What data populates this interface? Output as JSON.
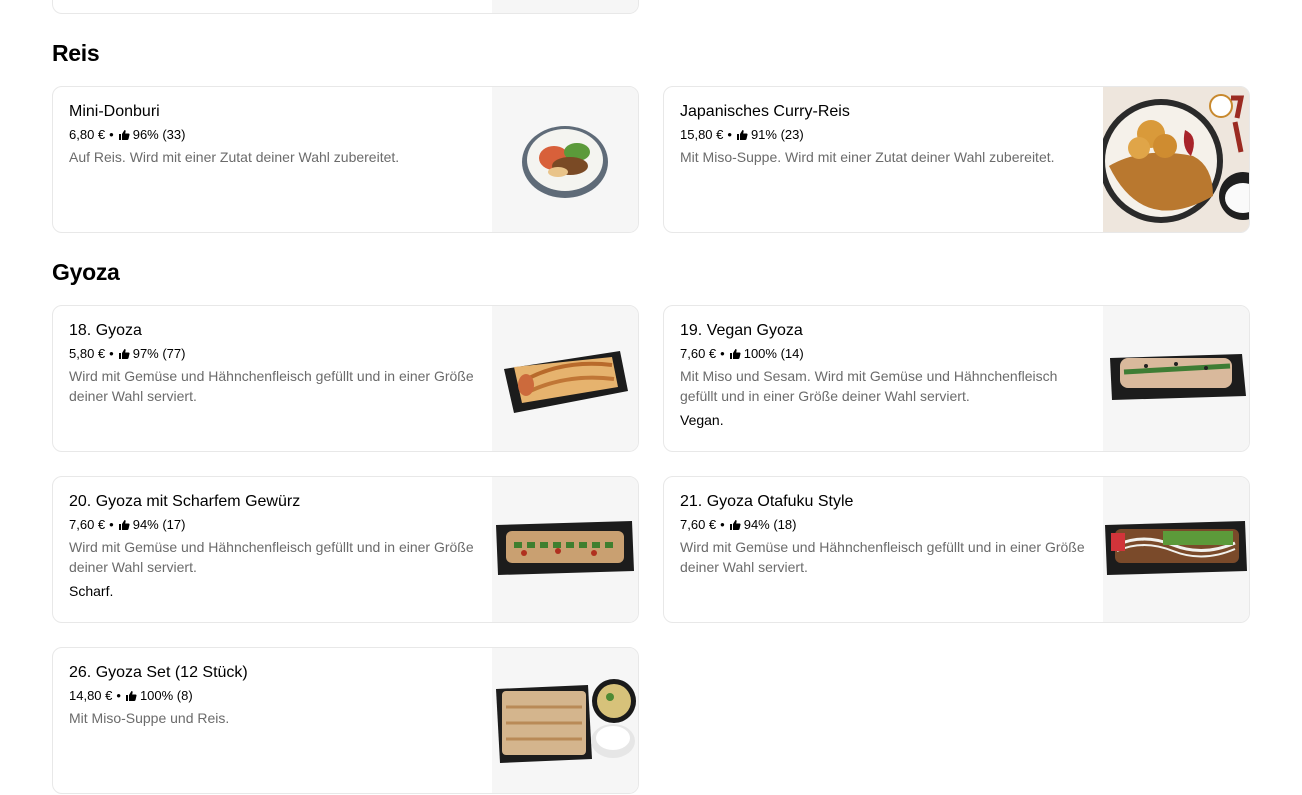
{
  "sections": [
    {
      "title": "Reis",
      "items": [
        {
          "name": "Mini-Donburi",
          "price": "6,80 €",
          "rating": "96% (33)",
          "description": "Auf Reis. Wird mit einer Zutat deiner Wahl zubereitet.",
          "tag": ""
        },
        {
          "name": "Japanisches Curry-Reis",
          "price": "15,80 €",
          "rating": "91% (23)",
          "description": "Mit Miso-Suppe. Wird mit einer Zutat deiner Wahl zubereitet.",
          "tag": ""
        }
      ]
    },
    {
      "title": "Gyoza",
      "items": [
        {
          "name": "18. Gyoza",
          "price": "5,80 €",
          "rating": "97% (77)",
          "description": "Wird mit Gemüse und Hähnchenfleisch gefüllt und in einer Größe deiner Wahl serviert.",
          "tag": ""
        },
        {
          "name": "19. Vegan Gyoza",
          "price": "7,60 €",
          "rating": "100% (14)",
          "description": "Mit Miso und Sesam. Wird mit Gemüse und Hähnchenfleisch gefüllt und in einer Größe deiner Wahl serviert.",
          "tag": "Vegan."
        },
        {
          "name": "20. Gyoza mit Scharfem Gewürz",
          "price": "7,60 €",
          "rating": "94% (17)",
          "description": "Wird mit Gemüse und Hähnchenfleisch gefüllt und in einer Größe deiner Wahl serviert.",
          "tag": "Scharf."
        },
        {
          "name": "21. Gyoza Otafuku Style",
          "price": "7,60 €",
          "rating": "94% (18)",
          "description": "Wird mit Gemüse und Hähnchenfleisch gefüllt und in einer Größe deiner Wahl serviert.",
          "tag": ""
        },
        {
          "name": "26. Gyoza Set (12 Stück)",
          "price": "14,80 €",
          "rating": "100% (8)",
          "description": "Mit Miso-Suppe und Reis.",
          "tag": ""
        }
      ]
    }
  ],
  "ui": {
    "separator": "•",
    "rating_icon": "thumbs-up-icon",
    "card_border_color": "#e8e8e8",
    "image_bg_color": "#f6f6f6"
  }
}
